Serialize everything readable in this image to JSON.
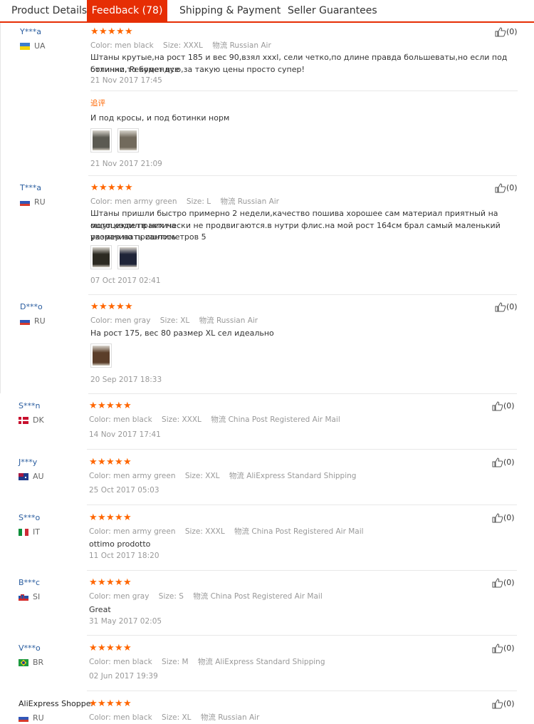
{
  "tabs": [
    {
      "label": "Product Details"
    },
    {
      "label": "Feedback (78)"
    },
    {
      "label": "Shipping & Payment"
    },
    {
      "label": "Seller Guarantees"
    }
  ],
  "labels": {
    "color": "Color:",
    "size": "Size:",
    "shipping": "物流",
    "append": "追评",
    "like_count": "(0)"
  },
  "reviews": [
    {
      "user": "Y***a",
      "country": "UA",
      "stars": 5,
      "color": "men black",
      "size": "XXXL",
      "shipping": "Russian Air",
      "text_lines": [
        "Штаны крутые,на рост 185 и вес 90,взял xxxl, сели четко,по длине правда большеваты,но если под ботинки,то будет все",
        "отлично. Рекомендую,за такую цены просто супер!"
      ],
      "date": "21 Nov 2017 17:45",
      "followup": {
        "text": "И под кросы, и под ботинки норм",
        "date": "21 Nov 2017 21:09"
      },
      "like": "(0)"
    },
    {
      "user": "T***a",
      "country": "RU",
      "stars": 5,
      "color": "men army green",
      "size": "L",
      "shipping": "Russian Air",
      "text_lines": [
        "Штаны пришли быстро примерно 2 недели,качество пошива хорошее сам материал приятный на ощуп.ездил в них на",
        "мотоцикле практически не продвигаются.в нутри флис.на мой рост 164см брал самый маленький размер но пришлось",
        "укорачивать сантиметров 5"
      ],
      "date": "07 Oct 2017 02:41",
      "like": "(0)"
    },
    {
      "user": "D***o",
      "country": "RU",
      "stars": 5,
      "color": "men gray",
      "size": "XL",
      "shipping": "Russian Air",
      "text_lines": [
        "На рост 175, вес 80 размер XL сел идеально"
      ],
      "date": "20 Sep 2017 18:33",
      "like": "(0)"
    },
    {
      "user": "S***n",
      "country": "DK",
      "stars": 5,
      "color": "men black",
      "size": "XXXL",
      "shipping": "China Post Registered Air Mail",
      "text_lines": [],
      "date": "14 Nov 2017 17:41",
      "like": "(0)"
    },
    {
      "user": "J***y",
      "country": "AU",
      "stars": 5,
      "color": "men army green",
      "size": "XXL",
      "shipping": "AliExpress Standard Shipping",
      "text_lines": [],
      "date": "25 Oct 2017 05:03",
      "like": "(0)"
    },
    {
      "user": "S***o",
      "country": "IT",
      "stars": 5,
      "color": "men army green",
      "size": "XXXL",
      "shipping": "China Post Registered Air Mail",
      "text_lines": [
        "ottimo prodotto"
      ],
      "date": "11 Oct 2017 18:20",
      "like": "(0)"
    },
    {
      "user": "B***c",
      "country": "SI",
      "stars": 5,
      "color": "men gray",
      "size": "S",
      "shipping": "China Post Registered Air Mail",
      "text_lines": [
        "Great"
      ],
      "date": "31 May 2017 02:05",
      "like": "(0)"
    },
    {
      "user": "V***o",
      "country": "BR",
      "stars": 5,
      "color": "men black",
      "size": "M",
      "shipping": "AliExpress Standard Shipping",
      "text_lines": [],
      "date": "02 Jun 2017 19:39",
      "like": "(0)"
    },
    {
      "user": "AliExpress Shopper",
      "country": "RU",
      "stars": 5,
      "color": "men black",
      "size": "XL",
      "shipping": "Russian Air",
      "text_lines": [],
      "date": "",
      "like": "(0)"
    }
  ],
  "colors": {
    "accent": "#e62e04",
    "star": "#ff6600",
    "username": "#2a5d9f",
    "append": "#ff6600"
  },
  "icons": {
    "like": "thumbs-up-icon",
    "star": "star-icon",
    "flag": "country-flag-icon"
  }
}
